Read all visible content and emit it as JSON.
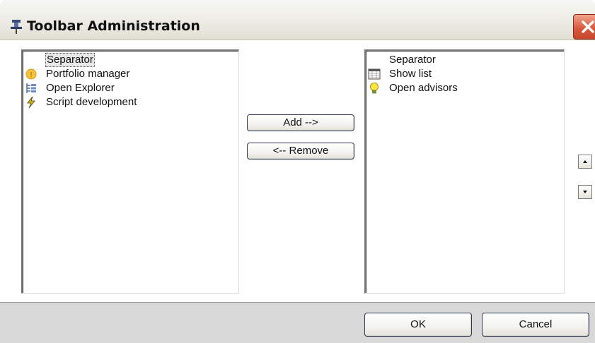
{
  "window": {
    "title": "Toolbar Administration"
  },
  "left_list": {
    "items": [
      {
        "label": "Separator",
        "icon": "none",
        "selected": true
      },
      {
        "label": "Portfolio manager",
        "icon": "portfolio-icon",
        "selected": false
      },
      {
        "label": "Open Explorer",
        "icon": "explorer-tree-icon",
        "selected": false
      },
      {
        "label": "Script development",
        "icon": "lightning-icon",
        "selected": false
      }
    ]
  },
  "right_list": {
    "items": [
      {
        "label": "Separator",
        "icon": "none"
      },
      {
        "label": "Show list",
        "icon": "list-icon"
      },
      {
        "label": "Open advisors",
        "icon": "lightbulb-icon"
      }
    ]
  },
  "buttons": {
    "add": "Add -->",
    "remove": "<-- Remove",
    "ok": "OK",
    "cancel": "Cancel"
  },
  "move_buttons": {
    "up_icon": "arrow-up-icon",
    "down_icon": "arrow-down-icon"
  },
  "colors": {
    "close_button": "#d7553a",
    "footer": "#d8d8d8",
    "list_bg": "#ffffff"
  }
}
